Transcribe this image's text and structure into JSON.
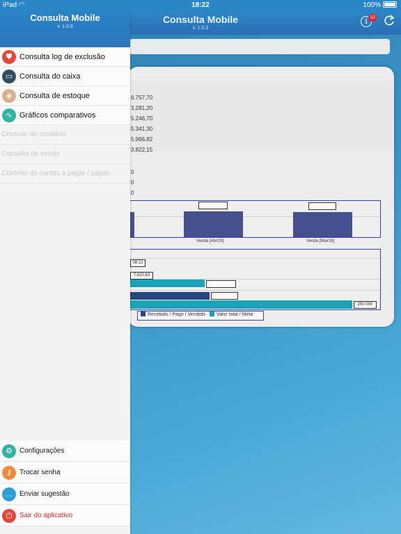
{
  "status_bar": {
    "device": "iPad",
    "time": "18:22",
    "battery": "100%"
  },
  "header": {
    "title": "Consulta Mobile",
    "version": "v. 1.0.3",
    "info_badge": "10"
  },
  "drawer": {
    "title": "Consulta Mobile",
    "version": "v. 1.0.3",
    "items": [
      {
        "label": "Consulta log de exclusão",
        "icon": "shield-icon",
        "color": "#e5473a"
      },
      {
        "label": "Consulta do caixa",
        "icon": "cash-register-icon",
        "color": "#2f4e63"
      },
      {
        "label": "Consulta de estoque",
        "icon": "stack-icon",
        "color": "#d9b08c"
      },
      {
        "label": "Gráficos comparativos",
        "icon": "wave-chart-icon",
        "color": "#2fb5a3"
      }
    ],
    "disabled_items": [
      {
        "label": "Controle de crediário"
      },
      {
        "label": "Consulta de venda"
      },
      {
        "label": "Controle de contas a pagar / pagas"
      }
    ],
    "bottom_items": [
      {
        "label": "Configurações",
        "icon": "settings-sliders-icon",
        "color": "#2fb5a3"
      },
      {
        "label": "Trocar senha",
        "icon": "key-icon",
        "color": "#ef8a3a"
      },
      {
        "label": "Enviar sugestão",
        "icon": "chat-bubble-icon",
        "color": "#2b9fd8"
      },
      {
        "label": "Sair do aplicativo",
        "icon": "power-icon",
        "color": "#e5473a",
        "text_color": "#e02424"
      }
    ]
  },
  "summary_values": [
    "6.757,70",
    "3.281,20",
    "5.246,70",
    "5.341,30",
    "5.966,82",
    "3.822,15"
  ],
  "summary_zeros": [
    "0",
    "0",
    "0"
  ],
  "chart_data": [
    {
      "type": "bar",
      "categories": [
        "",
        "Venda [Abr/20]",
        "Venda [Mai/19]"
      ],
      "series": [
        {
          "values": [
            null,
            null,
            null
          ]
        }
      ]
    },
    {
      "type": "bar",
      "orientation": "horizontal",
      "series": [
        {
          "name": "Recebido / Pago / Vendido"
        },
        {
          "name": "Valor total / Meta"
        }
      ],
      "data_labels": [
        "08.12",
        "7.620,63",
        "250.000"
      ]
    }
  ],
  "colors": {
    "accent": "#2a86c7",
    "bar_navy": "#44508f",
    "bar_teal": "#1aa3b8"
  }
}
